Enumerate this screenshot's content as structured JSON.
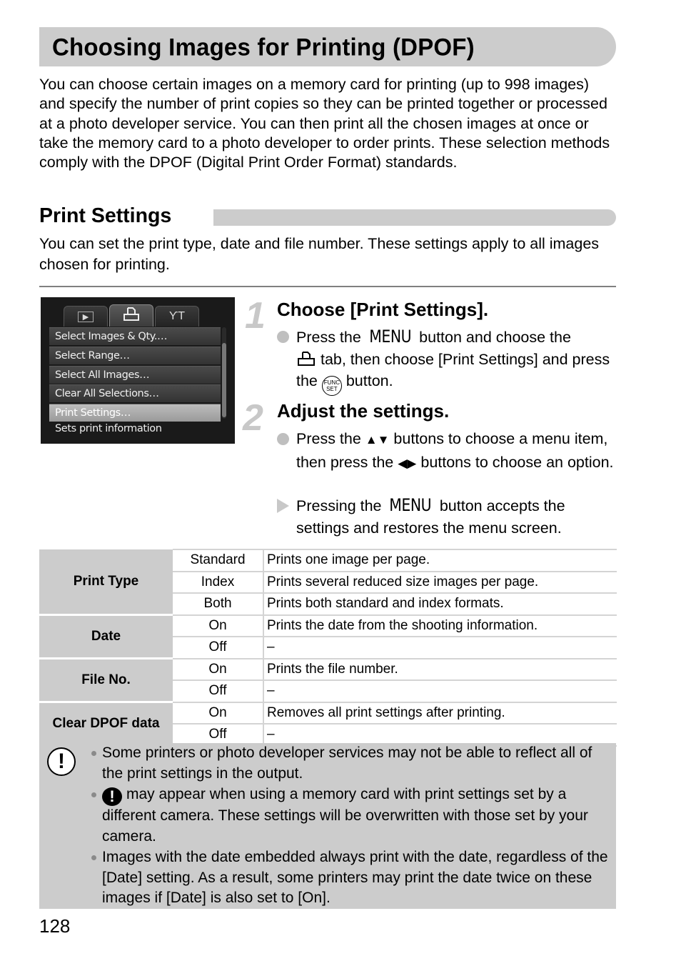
{
  "page": {
    "title": "Choosing Images for Printing (DPOF)",
    "intro": "You can choose certain images on a memory card for printing (up to 998 images) and specify the number of print copies so they can be printed together or processed at a photo developer service. You can then print all the chosen images at once or take the memory card to a photo developer to order prints. These selection methods comply with the DPOF (Digital Print Order Format) standards.",
    "page_number": "128"
  },
  "section": {
    "heading": "Print Settings",
    "intro": "You can set the print type, date and file number. These settings apply to all images chosen for printing."
  },
  "camera_screen": {
    "tabs": [
      {
        "icon": "playback-icon",
        "glyph": "▶"
      },
      {
        "icon": "print-icon",
        "glyph": "⎙"
      },
      {
        "icon": "tools-icon",
        "glyph": "ỶT"
      }
    ],
    "active_tab": 1,
    "items": [
      "Select Images & Qty.…",
      "Select Range…",
      "Select All Images…",
      "Clear All Selections…",
      "Print Settings…"
    ],
    "selected_item": 4,
    "status": "Sets print information"
  },
  "steps": [
    {
      "number": "1",
      "title": "Choose [Print Settings].",
      "bullet_1a": "Press the ",
      "bullet_1_menu": "MENU",
      "bullet_1b": " button and choose the",
      "bullet_1c": " tab, then choose [Print Settings] and press the ",
      "bullet_1_func": "FUNC.\nSET",
      "bullet_1d": " button."
    },
    {
      "number": "2",
      "title": "Adjust the settings.",
      "bullet_1a": "Press the ",
      "bullet_1_arrows_ud": "▲▼",
      "bullet_1b": " buttons to choose a menu item, then press the ",
      "bullet_1_arrows_lr": "◀▶",
      "bullet_1c": " buttons to choose an option.",
      "result_a": "Pressing the ",
      "result_menu": "MENU",
      "result_b": " button accepts the settings and restores the menu screen."
    }
  ],
  "settings_table": [
    {
      "category": "Print Type",
      "options": [
        {
          "option": "Standard",
          "description": "Prints one image per page."
        },
        {
          "option": "Index",
          "description": "Prints several reduced size images per page."
        },
        {
          "option": "Both",
          "description": "Prints both standard and index formats."
        }
      ]
    },
    {
      "category": "Date",
      "options": [
        {
          "option": "On",
          "description": "Prints the date from the shooting information."
        },
        {
          "option": "Off",
          "description": "–"
        }
      ]
    },
    {
      "category": "File No.",
      "options": [
        {
          "option": "On",
          "description": "Prints the file number."
        },
        {
          "option": "Off",
          "description": "–"
        }
      ]
    },
    {
      "category": "Clear DPOF data",
      "options": [
        {
          "option": "On",
          "description": "Removes all print settings after printing."
        },
        {
          "option": "Off",
          "description": "–"
        }
      ]
    }
  ],
  "notes": {
    "icon": "caution-icon",
    "items": [
      "Some printers or photo developer services may not be able to reflect all of the print settings in the output.",
      "may appear when using a memory card with print settings set by a different camera. These settings will be overwritten with those set by your camera.",
      "Images with the date embedded always print with the date, regardless of the [Date] setting. As a result, some printers may print the date twice on these images if [Date] is also set to [On]."
    ]
  }
}
